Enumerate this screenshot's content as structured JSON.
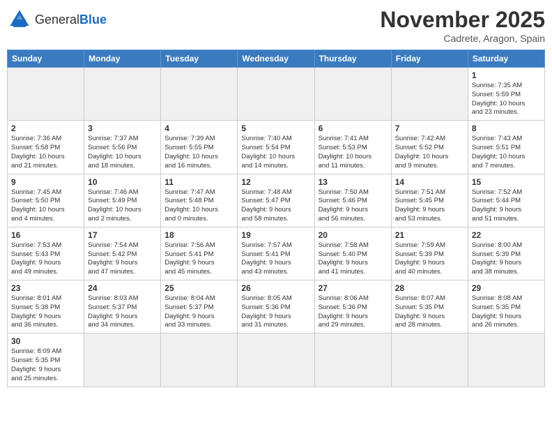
{
  "header": {
    "logo_general": "General",
    "logo_blue": "Blue",
    "month_title": "November 2025",
    "location": "Cadrete, Aragon, Spain"
  },
  "days_of_week": [
    "Sunday",
    "Monday",
    "Tuesday",
    "Wednesday",
    "Thursday",
    "Friday",
    "Saturday"
  ],
  "weeks": [
    [
      {
        "day": "",
        "info": "",
        "empty": true
      },
      {
        "day": "",
        "info": "",
        "empty": true
      },
      {
        "day": "",
        "info": "",
        "empty": true
      },
      {
        "day": "",
        "info": "",
        "empty": true
      },
      {
        "day": "",
        "info": "",
        "empty": true
      },
      {
        "day": "",
        "info": "",
        "empty": true
      },
      {
        "day": "1",
        "info": "Sunrise: 7:35 AM\nSunset: 5:59 PM\nDaylight: 10 hours\nand 23 minutes."
      }
    ],
    [
      {
        "day": "2",
        "info": "Sunrise: 7:36 AM\nSunset: 5:58 PM\nDaylight: 10 hours\nand 21 minutes."
      },
      {
        "day": "3",
        "info": "Sunrise: 7:37 AM\nSunset: 5:56 PM\nDaylight: 10 hours\nand 18 minutes."
      },
      {
        "day": "4",
        "info": "Sunrise: 7:39 AM\nSunset: 5:55 PM\nDaylight: 10 hours\nand 16 minutes."
      },
      {
        "day": "5",
        "info": "Sunrise: 7:40 AM\nSunset: 5:54 PM\nDaylight: 10 hours\nand 14 minutes."
      },
      {
        "day": "6",
        "info": "Sunrise: 7:41 AM\nSunset: 5:53 PM\nDaylight: 10 hours\nand 11 minutes."
      },
      {
        "day": "7",
        "info": "Sunrise: 7:42 AM\nSunset: 5:52 PM\nDaylight: 10 hours\nand 9 minutes."
      },
      {
        "day": "8",
        "info": "Sunrise: 7:43 AM\nSunset: 5:51 PM\nDaylight: 10 hours\nand 7 minutes."
      }
    ],
    [
      {
        "day": "9",
        "info": "Sunrise: 7:45 AM\nSunset: 5:50 PM\nDaylight: 10 hours\nand 4 minutes."
      },
      {
        "day": "10",
        "info": "Sunrise: 7:46 AM\nSunset: 5:49 PM\nDaylight: 10 hours\nand 2 minutes."
      },
      {
        "day": "11",
        "info": "Sunrise: 7:47 AM\nSunset: 5:48 PM\nDaylight: 10 hours\nand 0 minutes."
      },
      {
        "day": "12",
        "info": "Sunrise: 7:48 AM\nSunset: 5:47 PM\nDaylight: 9 hours\nand 58 minutes."
      },
      {
        "day": "13",
        "info": "Sunrise: 7:50 AM\nSunset: 5:46 PM\nDaylight: 9 hours\nand 56 minutes."
      },
      {
        "day": "14",
        "info": "Sunrise: 7:51 AM\nSunset: 5:45 PM\nDaylight: 9 hours\nand 53 minutes."
      },
      {
        "day": "15",
        "info": "Sunrise: 7:52 AM\nSunset: 5:44 PM\nDaylight: 9 hours\nand 51 minutes."
      }
    ],
    [
      {
        "day": "16",
        "info": "Sunrise: 7:53 AM\nSunset: 5:43 PM\nDaylight: 9 hours\nand 49 minutes."
      },
      {
        "day": "17",
        "info": "Sunrise: 7:54 AM\nSunset: 5:42 PM\nDaylight: 9 hours\nand 47 minutes."
      },
      {
        "day": "18",
        "info": "Sunrise: 7:56 AM\nSunset: 5:41 PM\nDaylight: 9 hours\nand 45 minutes."
      },
      {
        "day": "19",
        "info": "Sunrise: 7:57 AM\nSunset: 5:41 PM\nDaylight: 9 hours\nand 43 minutes."
      },
      {
        "day": "20",
        "info": "Sunrise: 7:58 AM\nSunset: 5:40 PM\nDaylight: 9 hours\nand 41 minutes."
      },
      {
        "day": "21",
        "info": "Sunrise: 7:59 AM\nSunset: 5:39 PM\nDaylight: 9 hours\nand 40 minutes."
      },
      {
        "day": "22",
        "info": "Sunrise: 8:00 AM\nSunset: 5:39 PM\nDaylight: 9 hours\nand 38 minutes."
      }
    ],
    [
      {
        "day": "23",
        "info": "Sunrise: 8:01 AM\nSunset: 5:38 PM\nDaylight: 9 hours\nand 36 minutes."
      },
      {
        "day": "24",
        "info": "Sunrise: 8:03 AM\nSunset: 5:37 PM\nDaylight: 9 hours\nand 34 minutes."
      },
      {
        "day": "25",
        "info": "Sunrise: 8:04 AM\nSunset: 5:37 PM\nDaylight: 9 hours\nand 33 minutes."
      },
      {
        "day": "26",
        "info": "Sunrise: 8:05 AM\nSunset: 5:36 PM\nDaylight: 9 hours\nand 31 minutes."
      },
      {
        "day": "27",
        "info": "Sunrise: 8:06 AM\nSunset: 5:36 PM\nDaylight: 9 hours\nand 29 minutes."
      },
      {
        "day": "28",
        "info": "Sunrise: 8:07 AM\nSunset: 5:35 PM\nDaylight: 9 hours\nand 28 minutes."
      },
      {
        "day": "29",
        "info": "Sunrise: 8:08 AM\nSunset: 5:35 PM\nDaylight: 9 hours\nand 26 minutes."
      }
    ],
    [
      {
        "day": "30",
        "info": "Sunrise: 8:09 AM\nSunset: 5:35 PM\nDaylight: 9 hours\nand 25 minutes."
      },
      {
        "day": "",
        "info": "",
        "empty": true
      },
      {
        "day": "",
        "info": "",
        "empty": true
      },
      {
        "day": "",
        "info": "",
        "empty": true
      },
      {
        "day": "",
        "info": "",
        "empty": true
      },
      {
        "day": "",
        "info": "",
        "empty": true
      },
      {
        "day": "",
        "info": "",
        "empty": true
      }
    ]
  ]
}
